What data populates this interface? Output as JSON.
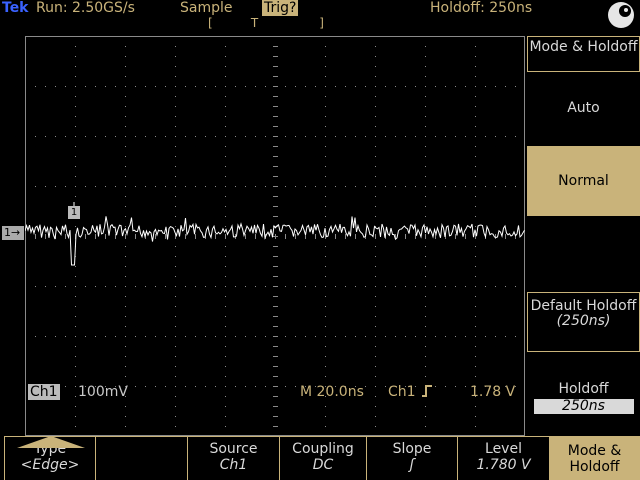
{
  "top": {
    "brand": "Tek",
    "run": "Run: 2.50GS/s",
    "acquisition": "Sample",
    "trigger_status": "Trig?",
    "holdoff": "Holdoff: 250ns",
    "trigger_position": "[          T                ]"
  },
  "screen": {
    "channel_marker": "1→",
    "trigger_marker": "1"
  },
  "readout": {
    "channel": "Ch1",
    "volts_per_div": "100mV",
    "timebase": "M 20.0ns",
    "trigger_source": "Ch1",
    "trigger_slope_icon": "rising-edge-icon",
    "trigger_level": "1.78 V"
  },
  "side_menu": {
    "title": "Mode & Holdoff",
    "auto": "Auto",
    "normal": "Normal",
    "default_holdoff": "Default Holdoff",
    "default_holdoff_value": "(250ns)",
    "holdoff": "Holdoff",
    "holdoff_value": "250ns"
  },
  "bottom_menu": {
    "type": {
      "label": "Type",
      "value": "<Edge>"
    },
    "source": {
      "label": "Source",
      "value": "Ch1"
    },
    "coupling": {
      "label": "Coupling",
      "value": "DC"
    },
    "slope": {
      "label": "Slope",
      "value": "ʃ"
    },
    "level": {
      "label": "Level",
      "value": "1.780 V"
    },
    "mode": {
      "label": "Mode & Holdoff"
    }
  },
  "colors": {
    "accent": "#c9b37a",
    "trace": "#ffffff",
    "grid": "#8a8a8a",
    "brand": "#3a62ff"
  }
}
